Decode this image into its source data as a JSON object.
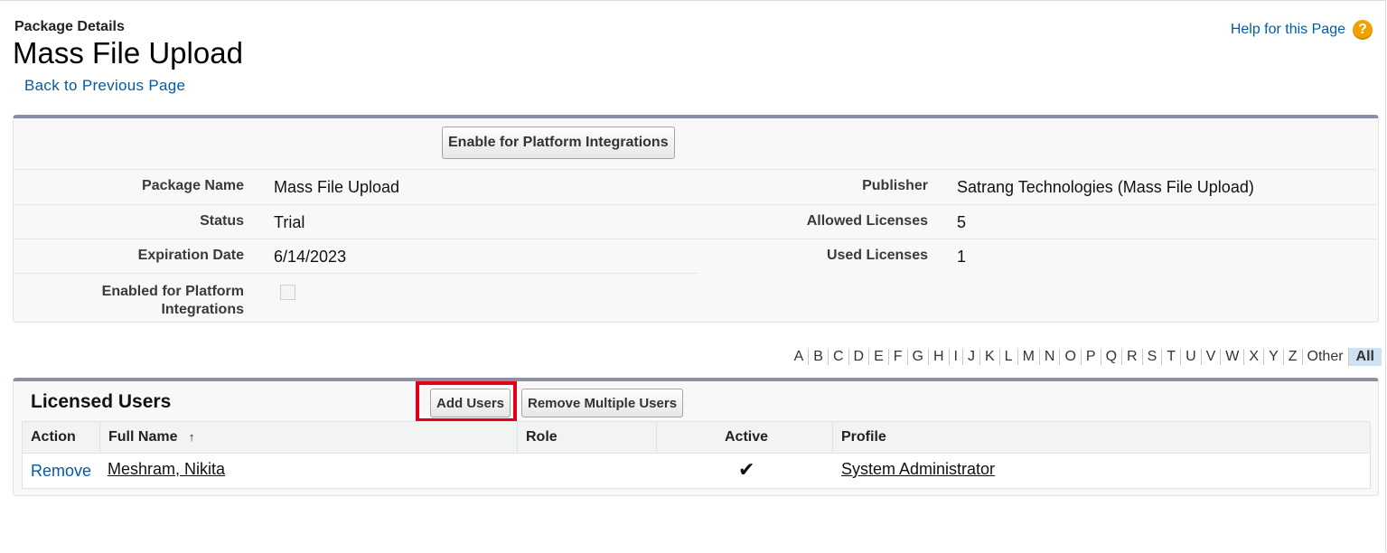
{
  "header": {
    "breadcrumb": "Package Details",
    "title": "Mass File Upload",
    "back_link": "Back to Previous Page",
    "help_link": "Help for this Page",
    "help_icon": "question-circle-icon"
  },
  "detail": {
    "enable_button": "Enable for Platform Integrations",
    "fields_left": [
      {
        "label": "Package Name",
        "value": "Mass File Upload"
      },
      {
        "label": "Status",
        "value": "Trial"
      },
      {
        "label": "Expiration Date",
        "value": "6/14/2023"
      },
      {
        "label_line1": "Enabled for Platform",
        "label_line2": "Integrations",
        "checked": false
      }
    ],
    "fields_right": [
      {
        "label": "Publisher",
        "value": "Satrang Technologies (Mass File Upload)"
      },
      {
        "label": "Allowed Licenses",
        "value": "5"
      },
      {
        "label": "Used Licenses",
        "value": "1"
      }
    ]
  },
  "alpha_filter": {
    "letters": [
      "A",
      "B",
      "C",
      "D",
      "E",
      "F",
      "G",
      "H",
      "I",
      "J",
      "K",
      "L",
      "M",
      "N",
      "O",
      "P",
      "Q",
      "R",
      "S",
      "T",
      "U",
      "V",
      "W",
      "X",
      "Y",
      "Z",
      "Other"
    ],
    "selected": "All"
  },
  "licensed_users": {
    "title": "Licensed Users",
    "add_button": "Add Users",
    "remove_multiple_button": "Remove Multiple Users",
    "columns": {
      "action": "Action",
      "full_name": "Full Name",
      "sort_indicator": "↑",
      "role": "Role",
      "active": "Active",
      "profile": "Profile"
    },
    "rows": [
      {
        "action": "Remove",
        "full_name": "Meshram, Nikita",
        "role": "",
        "active": true,
        "active_mark": "✔",
        "profile": "System Administrator"
      }
    ]
  },
  "colors": {
    "link": "#015ba7",
    "highlight": "#e3001b",
    "panel_border": "#8a8fa4",
    "help_icon": "#f2a000",
    "all_bg": "#cfe2f3"
  }
}
